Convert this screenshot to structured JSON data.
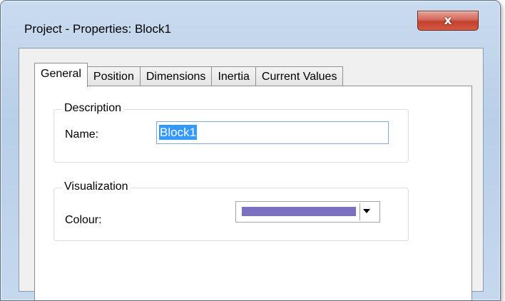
{
  "window": {
    "title": "Project - Properties: Block1",
    "close_glyph": "x"
  },
  "tabs": [
    {
      "label": "General",
      "active": true
    },
    {
      "label": "Position",
      "active": false
    },
    {
      "label": "Dimensions",
      "active": false
    },
    {
      "label": "Inertia",
      "active": false
    },
    {
      "label": "Current Values",
      "active": false
    }
  ],
  "description": {
    "group_label": "Description",
    "name_label": "Name:",
    "name_value": "Block1"
  },
  "visualization": {
    "group_label": "Visualization",
    "colour_label": "Colour:",
    "colour_value": "#7b6fc0"
  },
  "colors": {
    "accent_selection": "#3399ff",
    "close_button": "#c0402e"
  },
  "icons": {
    "close": "close-icon",
    "dropdown": "chevron-down-icon"
  }
}
